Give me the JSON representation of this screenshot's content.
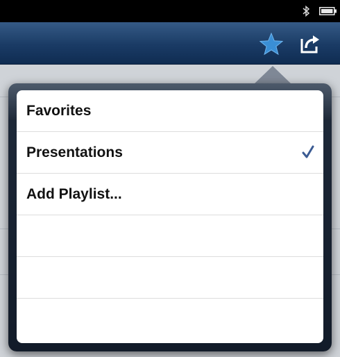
{
  "status_bar": {
    "bluetooth_icon": "bluetooth-icon",
    "battery_icon": "battery-icon"
  },
  "toolbar": {
    "star_icon": "star-icon",
    "share_icon": "share-icon",
    "star_color": "#3a8fd6"
  },
  "playlist_menu": {
    "items": [
      {
        "label": "Favorites",
        "checked": false
      },
      {
        "label": "Presentations",
        "checked": true
      },
      {
        "label": "Add Playlist...",
        "checked": false
      },
      {
        "label": "",
        "checked": false
      },
      {
        "label": "",
        "checked": false
      },
      {
        "label": "",
        "checked": false
      }
    ],
    "checkmark_color": "#3b5b93"
  }
}
